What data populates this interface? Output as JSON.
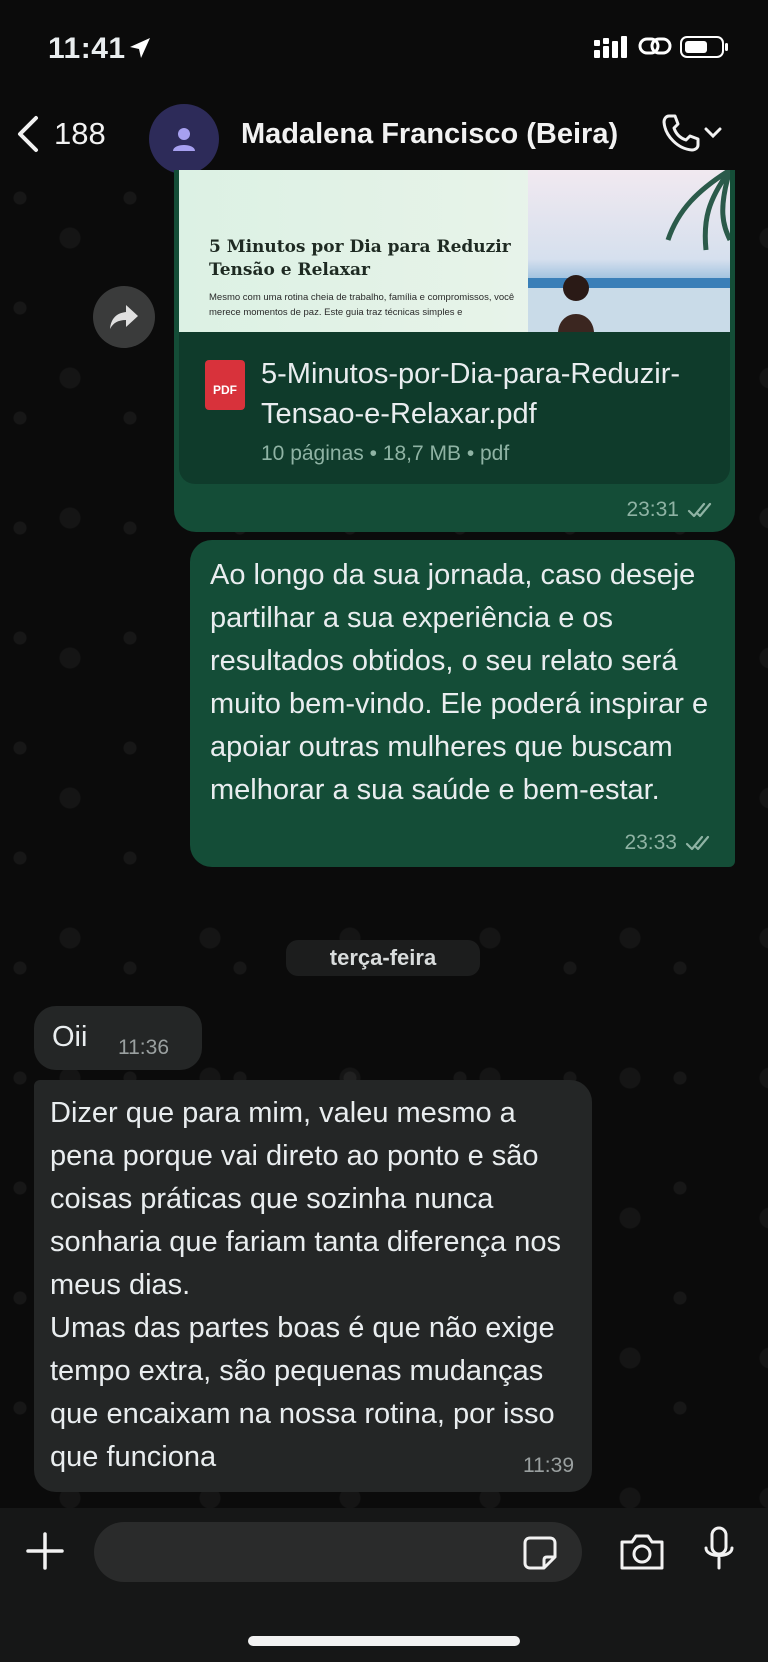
{
  "status_bar": {
    "time": "11:41"
  },
  "header": {
    "back_count": "188",
    "contact_name": "Madalena Francisco (Beira)"
  },
  "messages": {
    "document": {
      "preview_title": "5 Minutos por Dia para Reduzir Tensão e Relaxar",
      "preview_text": "Mesmo com uma rotina cheia de trabalho, família e compromissos, você merece momentos de paz. Este guia traz técnicas simples e",
      "filename": "5-Minutos-por-Dia-para-Reduzir-Tensao-e-Relaxar.pdf",
      "file_type_badge": "PDF",
      "meta": "10 páginas • 18,7 MB • pdf",
      "time": "23:31",
      "status_icon": "double-check-icon"
    },
    "outgoing_2": {
      "text": "Ao longo da sua jornada, caso deseje partilhar a sua experiência e os resultados obtidos, o seu relato será muito bem-vindo. Ele poderá inspirar e apoiar outras mulheres que buscam melhorar a sua saúde e bem-estar.",
      "time": "23:33"
    },
    "day_separator": "terça-feira",
    "incoming_1": {
      "text": "Oii",
      "time": "11:36"
    },
    "incoming_2": {
      "text": "Dizer que para mim, valeu mesmo a pena porque vai direto ao ponto e são coisas práticas que sozinha nunca sonharia que fariam tanta diferença nos meus dias.\nUmas das partes boas é que não exige tempo extra, são pequenas mudanças que encaixam na nossa rotina, por isso que funciona",
      "time": "11:39"
    }
  },
  "input_bar": {
    "placeholder": ""
  },
  "colors": {
    "outgoing_bubble": "#144d37",
    "incoming_bubble": "#242626",
    "background": "#0b0b0b",
    "pdf_badge": "#d8323b"
  }
}
